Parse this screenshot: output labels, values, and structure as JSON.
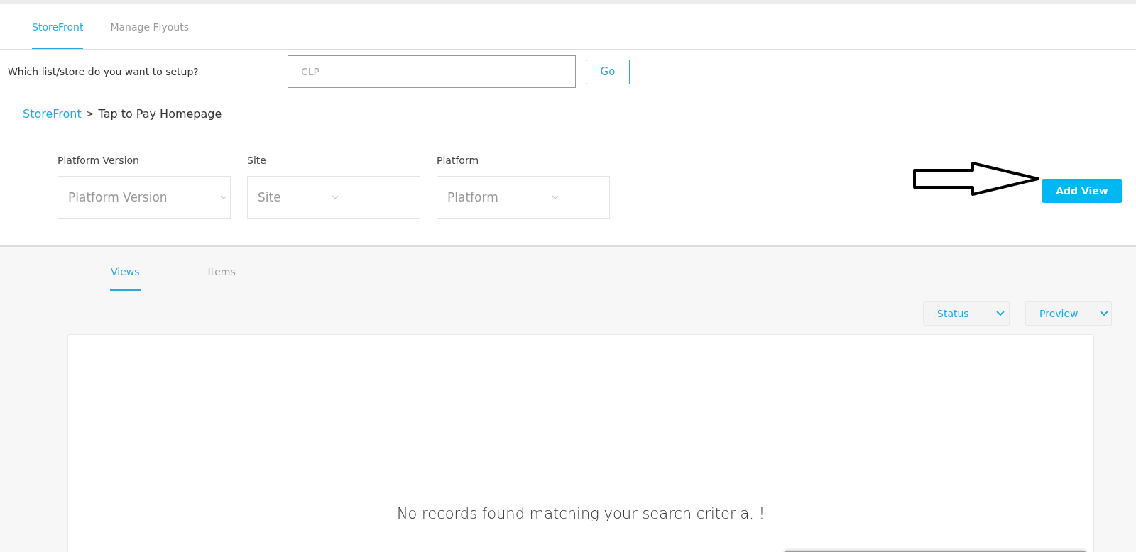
{
  "top_tabs": [
    {
      "label": "StoreFront",
      "selected": true
    },
    {
      "label": "Manage Flyouts",
      "selected": false
    }
  ],
  "setup": {
    "question": "Which list/store do you want to setup?",
    "store_field": {
      "placeholder": "CLP"
    },
    "go_button": "Go"
  },
  "breadcrumb": {
    "link": "StoreFront",
    "separator": ">",
    "current": "Tap to Pay Homepage"
  },
  "filters": [
    {
      "label": "Platform Version",
      "placeholder": "Platform Version"
    },
    {
      "label": "Site",
      "placeholder": "Site"
    },
    {
      "label": "Platform",
      "placeholder": "Platform"
    }
  ],
  "add_view_button": "Add View",
  "content_tabs": [
    {
      "label": "Views",
      "selected": true
    },
    {
      "label": "Items",
      "selected": false
    }
  ],
  "dropdowns": [
    "Status",
    "Preview"
  ],
  "empty_message": "No records found matching your search criteria. !"
}
